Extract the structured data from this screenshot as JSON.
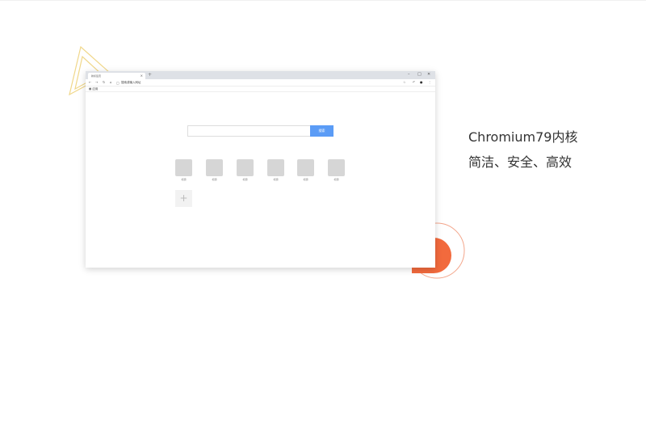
{
  "browser": {
    "tab_title": "新标签页",
    "tab_close": "×",
    "new_tab": "+",
    "window_controls": [
      "–",
      "□",
      "✕"
    ],
    "address_placeholder": "搜索或输入网址",
    "bookmark": "应用",
    "search_button": "搜索",
    "tiles": [
      "标题",
      "标题",
      "标题",
      "标题",
      "标题",
      "标题"
    ],
    "add_tile": "+"
  },
  "feature": {
    "title": "Chromium79内核",
    "subtitle": "简洁、安全、高效"
  },
  "colors": {
    "accent": "#f26a3d",
    "gold": "#f0d78a",
    "button": "#5b9cf6"
  }
}
